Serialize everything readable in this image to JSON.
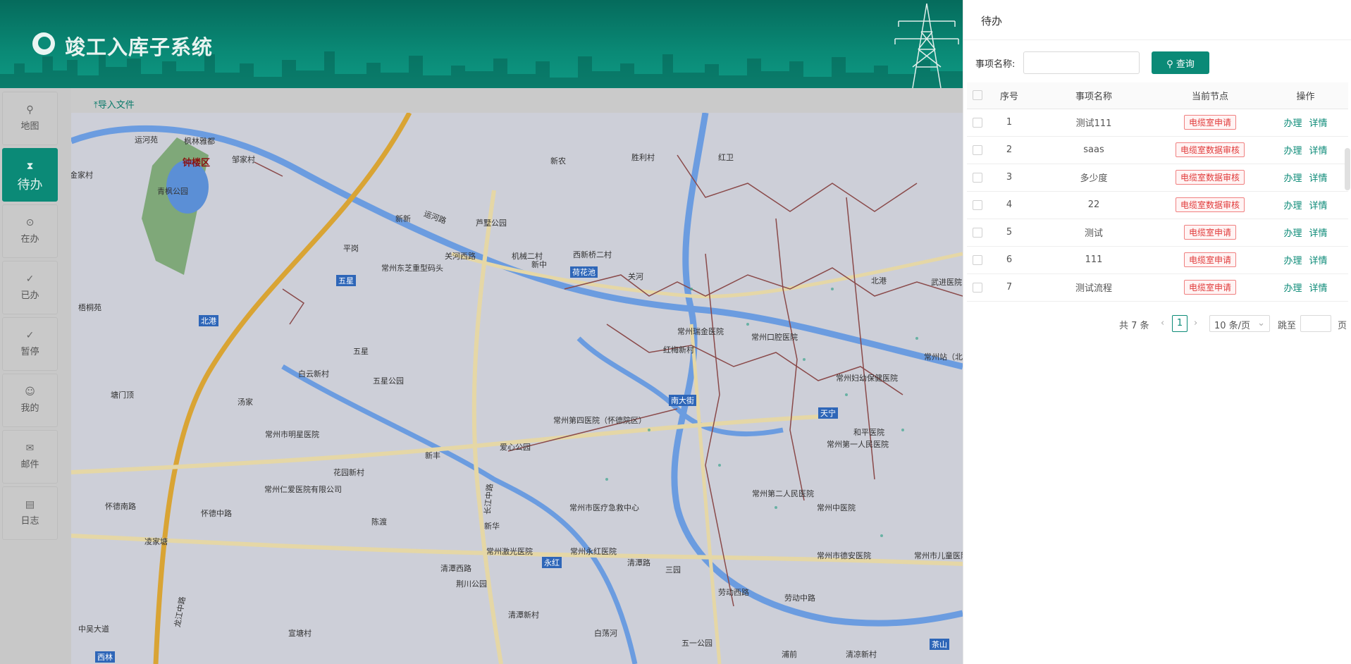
{
  "app": {
    "title": "竣工入库子系统"
  },
  "toolbar": {
    "import_label": "导入文件"
  },
  "sidebar": {
    "items": [
      {
        "label": "地图",
        "icon": "map-icon"
      },
      {
        "label": "待办",
        "icon": "hourglass-icon",
        "active": true
      },
      {
        "label": "在办",
        "icon": "play-circle-icon"
      },
      {
        "label": "已办",
        "icon": "check-circle-icon"
      },
      {
        "label": "暂停",
        "icon": "pause-icon"
      },
      {
        "label": "我的",
        "icon": "user-icon"
      },
      {
        "label": "邮件",
        "icon": "mail-icon"
      },
      {
        "label": "日志",
        "icon": "log-icon"
      }
    ]
  },
  "map_labels": [
    "运河苑",
    "枫林雅都",
    "钟楼区",
    "邹家村",
    "金家村",
    "青枫公园",
    "新农",
    "胜利村",
    "红卫",
    "新新",
    "平岗",
    "芦墅公园",
    "机械二村",
    "新中",
    "西新桥二村",
    "关河西路",
    "常州东芝重型码头",
    "五星",
    "荷花池",
    "北港",
    "梧桐苑",
    "五星",
    "白云新村",
    "五星公园",
    "常州瑞金医院",
    "红梅新村",
    "常州口腔医院",
    "常州妇幼保健医院",
    "塘门顶",
    "汤家",
    "常州市明星医院",
    "常州第四医院（怀德院区）",
    "南大街",
    "天宁",
    "和平医院",
    "常州第一人民医院",
    "花园新村",
    "常州仁爱医院有限公司",
    "新丰",
    "爱心公园",
    "怀德南路",
    "怀德中路",
    "陈渡",
    "常州市医疗急救中心",
    "常州第二人民医院",
    "常州中医院",
    "凌家塘",
    "新华",
    "常州激光医院",
    "常州永红医院",
    "永红",
    "清潭西路",
    "荆川公园",
    "清潭路",
    "三园",
    "常州市德安医院",
    "常州市儿童医院",
    "劳动西路",
    "劳动中路",
    "中吴大道",
    "宣塘村",
    "清潭新村",
    "白荡河",
    "五一公园",
    "浦前",
    "西林",
    "茶山",
    "清凉新村",
    "龙江中路",
    "长江中路",
    "运河路",
    "关河",
    "北港",
    "武进医院",
    "常州站（北）"
  ],
  "panel": {
    "title": "待办",
    "search_label": "事项名称:",
    "search_value": "",
    "search_button": "查询",
    "columns": [
      "序号",
      "事项名称",
      "当前节点",
      "操作"
    ],
    "rows": [
      {
        "no": "1",
        "name": "测试111",
        "node": "电缆室申请"
      },
      {
        "no": "2",
        "name": "saas",
        "node": "电缆室数据审核"
      },
      {
        "no": "3",
        "name": "多少度",
        "node": "电缆室数据审核"
      },
      {
        "no": "4",
        "name": "22",
        "node": "电缆室数据审核"
      },
      {
        "no": "5",
        "name": "测试",
        "node": "电缆室申请"
      },
      {
        "no": "6",
        "name": "111",
        "node": "电缆室申请"
      },
      {
        "no": "7",
        "name": "测试流程",
        "node": "电缆室申请"
      }
    ],
    "action_handle": "办理",
    "action_detail": "详情",
    "pager": {
      "total": "共 7 条",
      "current": "1",
      "page_size": "10 条/页",
      "jump_label": "跳至",
      "page_unit": "页"
    }
  }
}
